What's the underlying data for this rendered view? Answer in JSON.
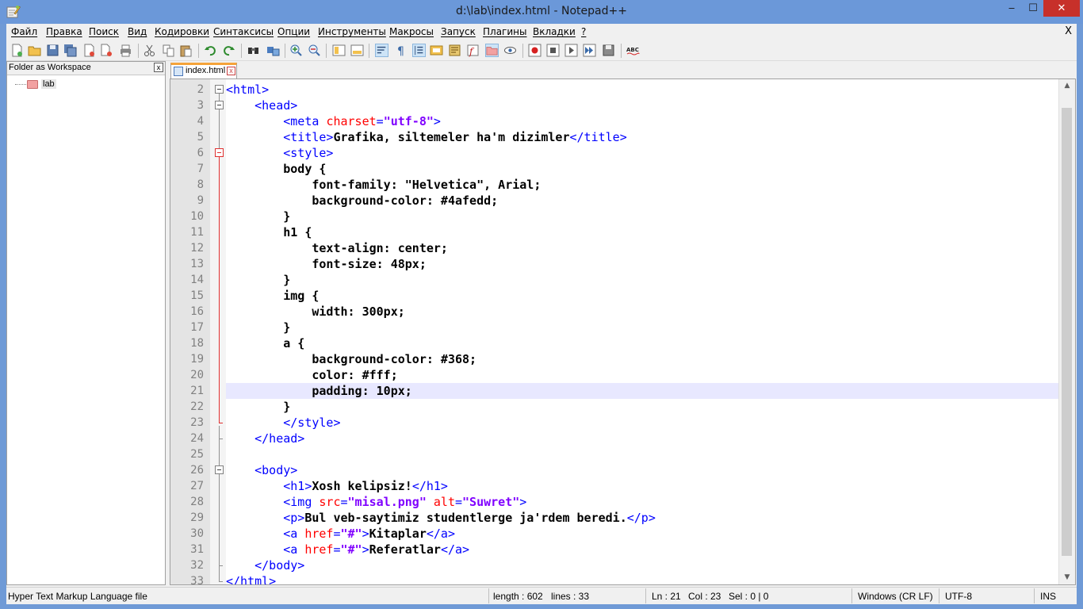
{
  "window": {
    "title": "d:\\lab\\index.html - Notepad++",
    "minimize": "‒",
    "maximize": "☐",
    "close": "✕"
  },
  "menu": {
    "items": [
      "Файл",
      "Правка",
      "Поиск",
      "Вид",
      "Кодировки",
      "Синтаксисы",
      "Опции",
      "Инструменты",
      "Макросы",
      "Запуск",
      "Плагины",
      "Вкладки",
      "?"
    ],
    "close_doc": "X"
  },
  "panel": {
    "title": "Folder as Workspace",
    "close": "x",
    "tree": [
      {
        "label": "lab"
      }
    ]
  },
  "tabs": [
    {
      "label": "index.html",
      "close": "x"
    }
  ],
  "editor": {
    "current_line": 21,
    "lines": [
      {
        "n": "2",
        "html": "<span class=\"tag\">&lt;html&gt;</span>"
      },
      {
        "n": "3",
        "html": "    <span class=\"tag\">&lt;head&gt;</span>"
      },
      {
        "n": "4",
        "html": "        <span class=\"tag\">&lt;meta </span><span class=\"attr\">charset</span><span class=\"tag\">=</span><span class=\"val\">\"utf-8\"</span><span class=\"tag\">&gt;</span>"
      },
      {
        "n": "5",
        "html": "        <span class=\"tag\">&lt;title&gt;</span><span class=\"txt\">Grafika, siltemeler ha'm dizimler</span><span class=\"tag\">&lt;/title&gt;</span>"
      },
      {
        "n": "6",
        "html": "        <span class=\"tag\">&lt;style&gt;</span>"
      },
      {
        "n": "7",
        "html": "        <span class=\"css\">body {</span>"
      },
      {
        "n": "8",
        "html": "            <span class=\"css\">font-family: \"Helvetica\", Arial;</span>"
      },
      {
        "n": "9",
        "html": "            <span class=\"css\">background-color: #4afedd;</span>"
      },
      {
        "n": "10",
        "html": "        <span class=\"css\">}</span>"
      },
      {
        "n": "11",
        "html": "        <span class=\"css\">h1 {</span>"
      },
      {
        "n": "12",
        "html": "            <span class=\"css\">text-align: center;</span>"
      },
      {
        "n": "13",
        "html": "            <span class=\"css\">font-size: 48px;</span>"
      },
      {
        "n": "14",
        "html": "        <span class=\"css\">}</span>"
      },
      {
        "n": "15",
        "html": "        <span class=\"css\">img {</span>"
      },
      {
        "n": "16",
        "html": "            <span class=\"css\">width: 300px;</span>"
      },
      {
        "n": "17",
        "html": "        <span class=\"css\">}</span>"
      },
      {
        "n": "18",
        "html": "        <span class=\"css\">a {</span>"
      },
      {
        "n": "19",
        "html": "            <span class=\"css\">background-color: #368;</span>"
      },
      {
        "n": "20",
        "html": "            <span class=\"css\">color: #fff;</span>"
      },
      {
        "n": "21",
        "html": "            <span class=\"css\">padding: 10px;</span>"
      },
      {
        "n": "22",
        "html": "        <span class=\"css\">}</span>"
      },
      {
        "n": "23",
        "html": "        <span class=\"tag\">&lt;/style&gt;</span>"
      },
      {
        "n": "24",
        "html": "    <span class=\"tag\">&lt;/head&gt;</span>"
      },
      {
        "n": "25",
        "html": ""
      },
      {
        "n": "26",
        "html": "    <span class=\"tag\">&lt;body&gt;</span>"
      },
      {
        "n": "27",
        "html": "        <span class=\"tag\">&lt;h1&gt;</span><span class=\"txt\">Xosh kelipsiz!</span><span class=\"tag\">&lt;/h1&gt;</span>"
      },
      {
        "n": "28",
        "html": "        <span class=\"tag\">&lt;img </span><span class=\"attr\">src</span><span class=\"tag\">=</span><span class=\"val\">\"misal.png\"</span><span class=\"tag\"> </span><span class=\"attr\">alt</span><span class=\"tag\">=</span><span class=\"val\">\"Suwret\"</span><span class=\"tag\">&gt;</span>"
      },
      {
        "n": "29",
        "html": "        <span class=\"tag\">&lt;p&gt;</span><span class=\"txt\">Bul veb-saytimiz studentlerge ja'rdem beredi.</span><span class=\"tag\">&lt;/p&gt;</span>"
      },
      {
        "n": "30",
        "html": "        <span class=\"tag\">&lt;a </span><span class=\"attr\">href</span><span class=\"tag\">=</span><span class=\"val\">\"#\"</span><span class=\"tag\">&gt;</span><span class=\"txt\">Kitaplar</span><span class=\"tag\">&lt;/a&gt;</span>"
      },
      {
        "n": "31",
        "html": "        <span class=\"tag\">&lt;a </span><span class=\"attr\">href</span><span class=\"tag\">=</span><span class=\"val\">\"#\"</span><span class=\"tag\">&gt;</span><span class=\"txt\">Referatlar</span><span class=\"tag\">&lt;/a&gt;</span>"
      },
      {
        "n": "32",
        "html": "    <span class=\"tag\">&lt;/body&gt;</span>"
      },
      {
        "n": "33",
        "html": "<span class=\"tag\">&lt;/html&gt;</span>"
      }
    ]
  },
  "statusbar": {
    "file_type": "Hyper Text Markup Language file",
    "length": "length : 602",
    "lines": "lines : 33",
    "ln": "Ln : 21",
    "col": "Col : 23",
    "sel": "Sel : 0 | 0",
    "eol": "Windows (CR LF)",
    "encoding": "UTF-8",
    "mode": "INS"
  },
  "toolbar": {
    "icons": [
      "new-icon",
      "open-icon",
      "save-icon",
      "save-all-icon",
      "close-icon",
      "close-all-icon",
      "print-icon",
      "cut-icon",
      "copy-icon",
      "paste-icon",
      "undo-icon",
      "redo-icon",
      "find-icon",
      "replace-icon",
      "zoom-in-icon",
      "zoom-out-icon",
      "sync-v-icon",
      "sync-h-icon",
      "word-wrap-icon",
      "show-all-chars-icon",
      "indent-guide-icon",
      "udl-icon",
      "doc-map-icon",
      "function-list-icon",
      "folder-workspace-icon",
      "monitor-icon",
      "record-macro-icon",
      "stop-record-icon",
      "play-macro-icon",
      "run-macro-multiple-icon",
      "save-macro-icon",
      "spell-check-icon"
    ]
  },
  "colors": {
    "titlebar": "#6b98d9",
    "close_button": "#c7302a",
    "tag": "#0000ff",
    "attribute": "#ff0000",
    "value": "#8000ff",
    "current_line": "#e8e8ff",
    "tab_accent": "#f5a33a"
  }
}
